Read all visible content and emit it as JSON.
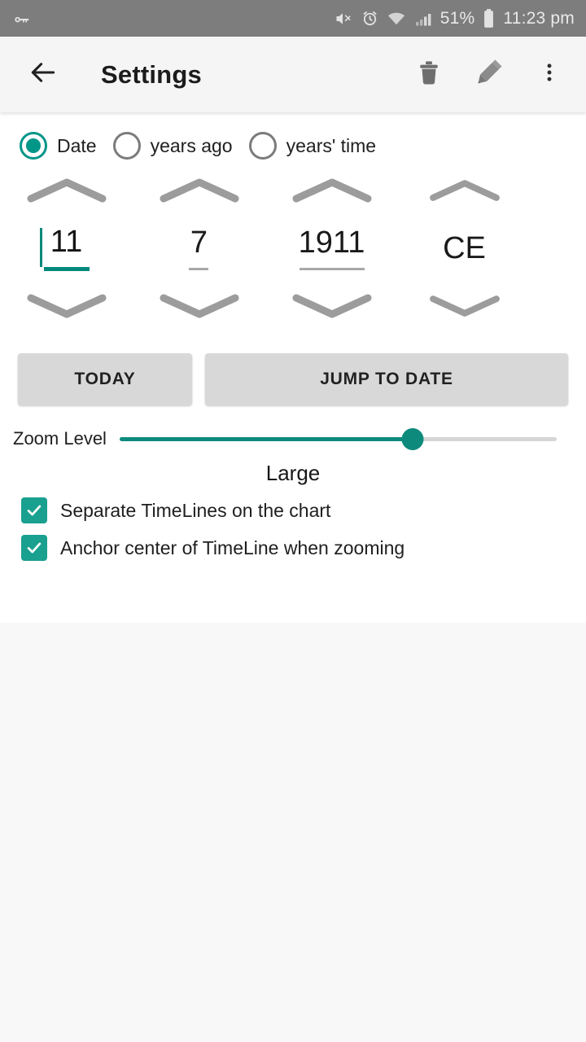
{
  "statusbar": {
    "vpn_icon": "key-icon",
    "icons": [
      "mute-icon",
      "alarm-icon",
      "wifi-icon",
      "signal-icon"
    ],
    "battery_percent": "51%",
    "battery_icon": "battery-icon",
    "time": "11:23 pm"
  },
  "appbar": {
    "back_icon": "back-arrow-icon",
    "title": "Settings",
    "delete_icon": "trash-icon",
    "edit_icon": "pencil-icon",
    "overflow_icon": "more-vert-icon"
  },
  "mode": {
    "options": [
      {
        "label": "Date",
        "selected": true
      },
      {
        "label": "years ago",
        "selected": false
      },
      {
        "label": "years' time",
        "selected": false
      }
    ]
  },
  "date_spinners": [
    {
      "name": "day",
      "value": "11",
      "focused": true,
      "editable": true
    },
    {
      "name": "month",
      "value": "7",
      "focused": false,
      "editable": true
    },
    {
      "name": "year",
      "value": "1911",
      "focused": false,
      "editable": true
    },
    {
      "name": "era",
      "value": "CE",
      "focused": false,
      "editable": false
    }
  ],
  "buttons": {
    "today": "TODAY",
    "jump_to_date": "JUMP TO DATE"
  },
  "zoom": {
    "label": "Zoom Level",
    "value_label": "Large",
    "percent": 67
  },
  "checkboxes": [
    {
      "label": "Separate TimeLines on the chart",
      "checked": true
    },
    {
      "label": "Anchor center of TimeLine when zooming",
      "checked": true
    }
  ],
  "colors": {
    "accent": "#009688",
    "slider": "#0e8a7d",
    "checkbox": "#1aa08f",
    "statusbar": "#7d7d7d",
    "appbar": "#f5f5f5",
    "button": "#d8d8d8"
  }
}
